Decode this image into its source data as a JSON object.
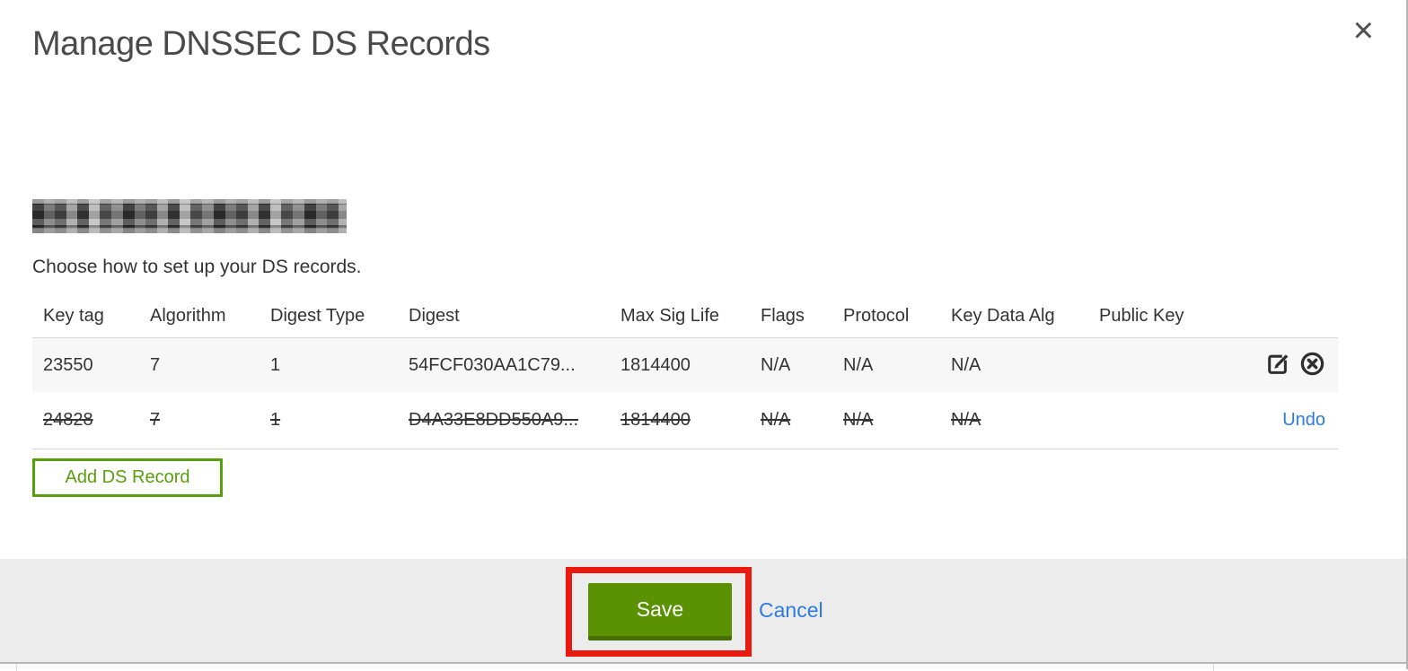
{
  "modal": {
    "title": "Manage DNSSEC DS Records",
    "close_icon": "×",
    "domain": {
      "redacted": true,
      "note": "domain name pixelated/blurred in screenshot"
    },
    "instruction": "Choose how to set up your DS records."
  },
  "table": {
    "columns": [
      "Key tag",
      "Algorithm",
      "Digest Type",
      "Digest",
      "Max Sig Life",
      "Flags",
      "Protocol",
      "Key Data Alg",
      "Public Key"
    ],
    "rows": [
      {
        "key_tag": "23550",
        "algorithm": "7",
        "digest_type": "1",
        "digest": "54FCF030AA1C79...",
        "max_sig_life": "1814400",
        "flags": "N/A",
        "protocol": "N/A",
        "key_data_alg": "N/A",
        "public_key": "",
        "state": "active",
        "actions": [
          "edit",
          "delete"
        ]
      },
      {
        "key_tag": "24828",
        "algorithm": "7",
        "digest_type": "1",
        "digest": "D4A33E8DD550A9...",
        "max_sig_life": "1814400",
        "flags": "N/A",
        "protocol": "N/A",
        "key_data_alg": "N/A",
        "public_key": "",
        "state": "deleted",
        "undo_label": "Undo"
      }
    ],
    "add_button_label": "Add DS Record"
  },
  "footer": {
    "save_label": "Save",
    "cancel_label": "Cancel",
    "annotation": {
      "shape": "red-rectangle",
      "purpose": "highlights the Save button",
      "color": "#ea1a10"
    }
  },
  "icons": {
    "close": "x-cross",
    "edit": "pencil-on-square",
    "delete": "x-in-circle"
  },
  "colors": {
    "save_button_green": "#5b9204",
    "save_button_border": "#456e04",
    "add_button_green": "#58a00b",
    "link_blue": "#2e7bde",
    "footer_gray": "#ececec",
    "row_stripe": "#f7f7f7",
    "annotation_red": "#ea1a10",
    "text": "#333333",
    "title_text": "#4a4a4a"
  }
}
